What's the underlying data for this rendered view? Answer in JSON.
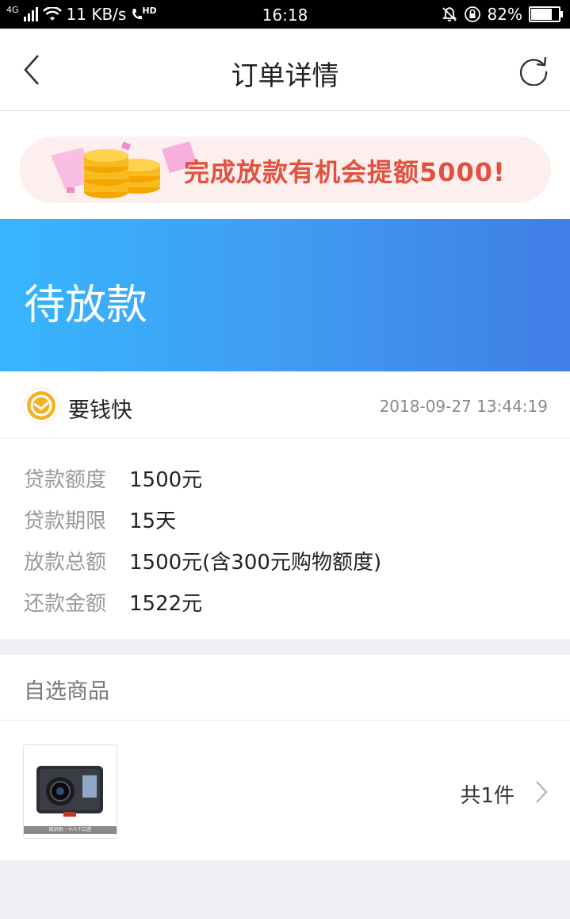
{
  "status_bar": {
    "network": "4G",
    "speed": "11 KB/s",
    "hd": "HD",
    "time": "16:18",
    "battery": "82%",
    "battery_level": 0.82
  },
  "nav": {
    "title": "订单详情",
    "back_icon": "chevron-left-icon",
    "refresh_icon": "refresh-icon"
  },
  "banner": {
    "text": "完成放款有机会提额5000!"
  },
  "order_status": {
    "label": "待放款"
  },
  "merchant": {
    "name": "要钱快",
    "timestamp": "2018-09-27 13:44:19"
  },
  "details": [
    {
      "key": "贷款额度",
      "value": "1500元"
    },
    {
      "key": "贷款期限",
      "value": "15天"
    },
    {
      "key": "放款总额",
      "value": "1500元(含300元购物额度)"
    },
    {
      "key": "还款金额",
      "value": "1522元"
    }
  ],
  "goods": {
    "section_title": "自选商品",
    "count_label": "共1件",
    "thumb_caption": "能识别 · 十八个口音",
    "colors": {
      "accent_gradient_start": "#38b6fd",
      "accent_gradient_end": "#417ee6",
      "banner_text": "#e2513f"
    }
  }
}
